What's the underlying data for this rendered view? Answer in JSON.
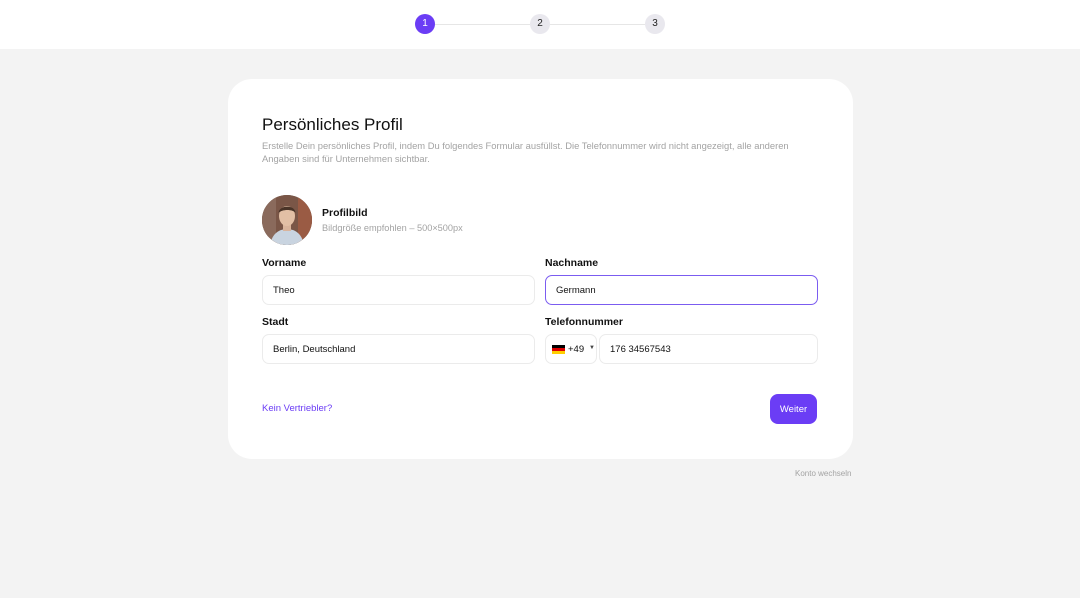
{
  "stepper": {
    "steps": [
      {
        "label": "1",
        "active": true
      },
      {
        "label": "2",
        "active": false
      },
      {
        "label": "3",
        "active": false
      }
    ],
    "accent_color": "#6b3df5"
  },
  "form": {
    "title": "Persönliches Profil",
    "description": "Erstelle Dein persönliches Profil, indem Du folgendes Formular ausfüllst. Die Telefonnummer wird nicht angezeigt, alle anderen Angaben sind für Unternehmen sichtbar.",
    "profile_picture": {
      "title": "Profilbild",
      "hint": "Bildgröße empfohlen – 500×500px"
    },
    "first_name": {
      "label": "Vorname",
      "value": "Theo"
    },
    "last_name": {
      "label": "Nachname",
      "value": "Germann"
    },
    "city": {
      "label": "Stadt",
      "value": "Berlin, Deutschland"
    },
    "phone": {
      "label": "Telefonnummer",
      "country_flag": "germany-flag",
      "country_code": "+49",
      "value": "176 34567543"
    },
    "secondary_link": "Kein Vertriebler?",
    "submit_label": "Weiter"
  },
  "footer": {
    "switch_account": "Konto wechseln"
  }
}
